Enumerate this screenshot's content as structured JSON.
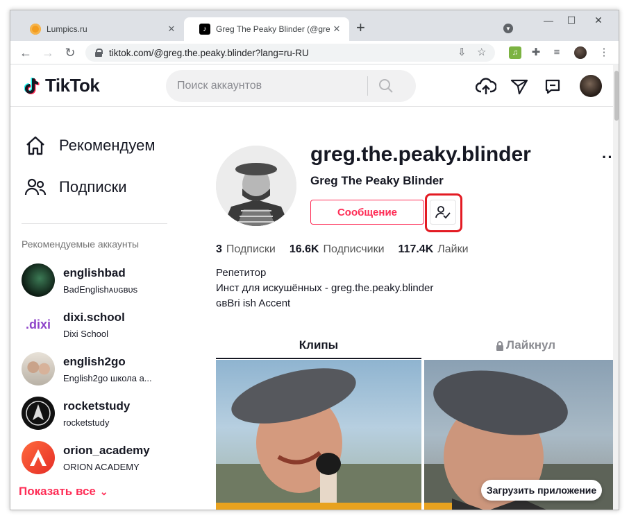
{
  "browser": {
    "tabs": [
      {
        "title": "Lumpics.ru",
        "active": false
      },
      {
        "title": "Greg The Peaky Blinder (@greg.th",
        "active": true
      }
    ],
    "new_tab_symbol": "+",
    "close_symbol": "✕",
    "window_controls": {
      "minimize": "—",
      "maximize": "☐",
      "close": "✕"
    },
    "url": "tiktok.com/@greg.the.peaky.blinder?lang=ru-RU"
  },
  "tiktok": {
    "logo_text": "TikTok",
    "search_placeholder": "Поиск аккаунтов",
    "brand_colors": {
      "red": "#fe2c55",
      "cyan": "#25f4ee"
    }
  },
  "sidebar": {
    "nav": [
      {
        "label": "Рекомендуем",
        "icon": "home-icon"
      },
      {
        "label": "Подписки",
        "icon": "following-icon"
      }
    ],
    "suggested_caption": "Рекомендуемые аккаунты",
    "accounts": [
      {
        "username": "englishbad",
        "display": "BadEnglishᴀᴜɢʙᴜs"
      },
      {
        "username": "dixi.school",
        "display": "Dixi School",
        "logo_text": ".dixi"
      },
      {
        "username": "english2go",
        "display": "English2go школа а..."
      },
      {
        "username": "rocketstudy",
        "display": "rocketstudy"
      },
      {
        "username": "orion_academy",
        "display": "ORION ACADEMY"
      }
    ],
    "show_all": "Показать все"
  },
  "profile": {
    "username": "greg.the.peaky.blinder",
    "nickname": "Greg The Peaky Blinder",
    "message_button": "Сообщение",
    "more": "···",
    "stats": {
      "following_count": "3",
      "following_label": "Подписки",
      "followers_count": "16.6K",
      "followers_label": "Подписчики",
      "likes_count": "117.4K",
      "likes_label": "Лайки"
    },
    "bio": [
      "Репетитор",
      "Инст для искушённых - greg.the.peaky.blinder",
      "ɢʙBri ish Accent"
    ],
    "tabs": {
      "videos": "Клипы",
      "liked": "Лайкнул"
    },
    "download_app": "Загрузить приложение"
  }
}
